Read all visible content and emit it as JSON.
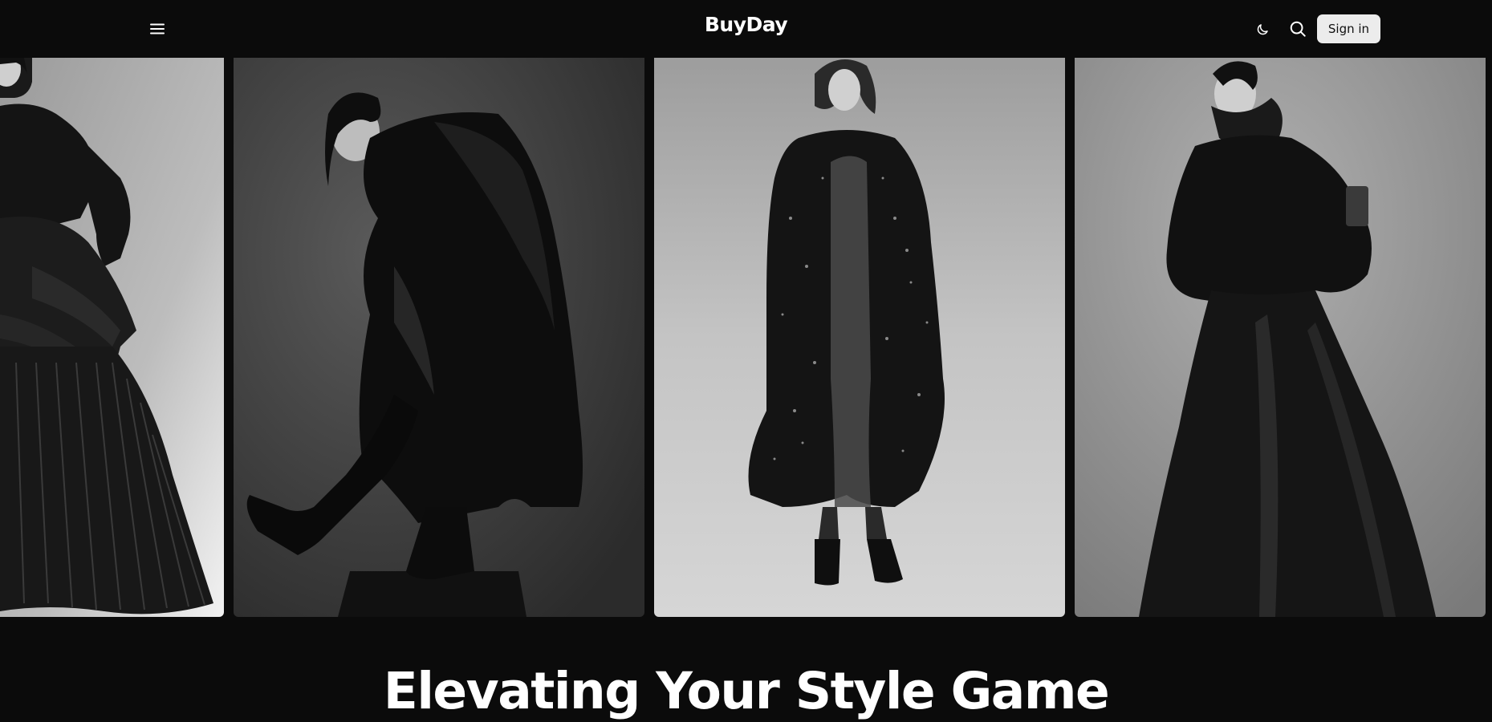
{
  "header": {
    "brand": "BuyDay",
    "menu_icon": "hamburger-menu-icon",
    "theme_icon": "moon-icon",
    "search_icon": "search-icon",
    "signin_label": "Sign in"
  },
  "gallery": {
    "images": [
      {
        "name": "model-pleated-gown-photo",
        "tone": "light-gray background"
      },
      {
        "name": "model-leather-coat-photo",
        "tone": "dark-gray background"
      },
      {
        "name": "model-sequin-coat-photo",
        "tone": "light-gray background"
      },
      {
        "name": "model-bomber-gown-photo",
        "tone": "mid-gray background"
      }
    ]
  },
  "hero": {
    "headline": "Elevating Your Style Game"
  },
  "colors": {
    "background": "#0b0b0b",
    "signin_button": "#ececec",
    "text": "#ffffff"
  }
}
